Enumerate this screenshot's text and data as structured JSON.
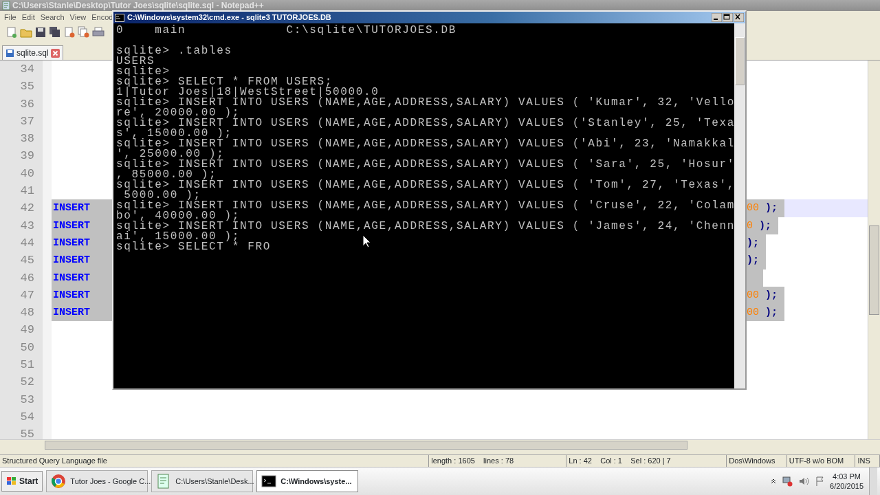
{
  "notepad": {
    "title": "C:\\Users\\Stanle\\Desktop\\Tutor Joes\\sqlite\\sqlite.sql - Notepad++",
    "menu": [
      "File",
      "Edit",
      "Search",
      "View",
      "Encod"
    ],
    "tabs": [
      {
        "label": "sqlite.sql",
        "selected": true
      }
    ],
    "lines": [
      {
        "number": "34",
        "selected": false,
        "current": false
      },
      {
        "number": "35",
        "selected": false,
        "current": false
      },
      {
        "number": "36",
        "selected": false,
        "current": false
      },
      {
        "number": "37",
        "selected": false,
        "current": false
      },
      {
        "number": "38",
        "selected": false,
        "current": false
      },
      {
        "number": "39",
        "selected": false,
        "current": false
      },
      {
        "number": "40",
        "selected": false,
        "current": false
      },
      {
        "number": "41",
        "selected": false,
        "current": false
      },
      {
        "number": "42",
        "selected": true,
        "current": true,
        "keyword": "INSERT",
        "digits": "00",
        "tail": ");"
      },
      {
        "number": "43",
        "selected": true,
        "current": false,
        "keyword": "INSERT",
        "digits": "0",
        "tail": ");"
      },
      {
        "number": "44",
        "selected": true,
        "current": false,
        "keyword": "INSERT",
        "tail": ");"
      },
      {
        "number": "45",
        "selected": true,
        "current": false,
        "keyword": "INSERT",
        "tail": ");"
      },
      {
        "number": "46",
        "selected": true,
        "current": false,
        "keyword": "INSERT"
      },
      {
        "number": "47",
        "selected": true,
        "current": false,
        "keyword": "INSERT",
        "digits": "00",
        "tail": ");"
      },
      {
        "number": "48",
        "selected": true,
        "current": false,
        "keyword": "INSERT",
        "digits": "00",
        "tail": ");"
      },
      {
        "number": "49",
        "selected": false,
        "current": false
      },
      {
        "number": "50",
        "selected": false,
        "current": false
      },
      {
        "number": "51",
        "selected": false,
        "current": false
      },
      {
        "number": "52",
        "selected": false,
        "current": false
      },
      {
        "number": "53",
        "selected": false,
        "current": false
      },
      {
        "number": "54",
        "selected": false,
        "current": false
      },
      {
        "number": "55",
        "selected": false,
        "current": false
      }
    ],
    "status_bar": [
      "Structured Query Language file",
      "length : 1605    lines : 78",
      "Ln : 42    Col : 1    Sel : 620 | 7",
      "Dos\\Windows",
      "UTF-8 w/o BOM",
      "INS"
    ]
  },
  "console": {
    "title": "C:\\Windows\\system32\\cmd.exe - sqlite3  TUTORJOES.DB",
    "lines": [
      {
        "text": "0    main             C:\\sqlite\\TUTORJOES.DB",
        "gap_before": false
      },
      {
        "text": "sqlite> .tables",
        "gap_before": true
      },
      {
        "text": "USERS",
        "gap_before": false
      },
      {
        "text": "sqlite>",
        "gap_before": false
      },
      {
        "text": "sqlite> SELECT * FROM USERS;",
        "gap_before": false
      },
      {
        "text": "1|Tutor Joes|18|WestStreet|50000.0",
        "gap_before": false
      },
      {
        "text": "sqlite> INSERT INTO USERS (NAME,AGE,ADDRESS,SALARY) VALUES ( 'Kumar', 32, 'Vello",
        "gap_before": false
      },
      {
        "text": "re', 20000.00 );",
        "gap_before": false
      },
      {
        "text": "sqlite> INSERT INTO USERS (NAME,AGE,ADDRESS,SALARY) VALUES ('Stanley', 25, 'Texa",
        "gap_before": false
      },
      {
        "text": "s', 15000.00 );",
        "gap_before": false
      },
      {
        "text": "sqlite> INSERT INTO USERS (NAME,AGE,ADDRESS,SALARY) VALUES ('Abi', 23, 'Namakkal",
        "gap_before": false
      },
      {
        "text": "', 25000.00 );",
        "gap_before": false
      },
      {
        "text": "sqlite> INSERT INTO USERS (NAME,AGE,ADDRESS,SALARY) VALUES ( 'Sara', 25, 'Hosur'",
        "gap_before": false
      },
      {
        "text": ", 85000.00 );",
        "gap_before": false
      },
      {
        "text": "sqlite> INSERT INTO USERS (NAME,AGE,ADDRESS,SALARY) VALUES ( 'Tom', 27, 'Texas',",
        "gap_before": false
      },
      {
        "text": " 5000.00 );",
        "gap_before": false
      },
      {
        "text": "sqlite> INSERT INTO USERS (NAME,AGE,ADDRESS,SALARY) VALUES ( 'Cruse', 22, 'Colam",
        "gap_before": false
      },
      {
        "text": "bo', 40000.00 );",
        "gap_before": false
      },
      {
        "text": "sqlite> INSERT INTO USERS (NAME,AGE,ADDRESS,SALARY) VALUES ( 'James', 24, 'Chenn",
        "gap_before": false
      },
      {
        "text": "ai', 15000.00 );",
        "gap_before": false
      },
      {
        "text": "sqlite> SELECT * FRO",
        "gap_before": false
      }
    ]
  },
  "taskbar": {
    "start": "Start",
    "buttons": [
      {
        "label": "Tutor Joes - Google C...",
        "kind": "browser",
        "selected": false
      },
      {
        "label": "C:\\Users\\Stanle\\Desk...",
        "kind": "editor",
        "selected": false
      },
      {
        "label": "C:\\Windows\\syste...",
        "kind": "console",
        "selected": true
      }
    ],
    "time": "4:03 PM",
    "date": "6/20/2015"
  }
}
